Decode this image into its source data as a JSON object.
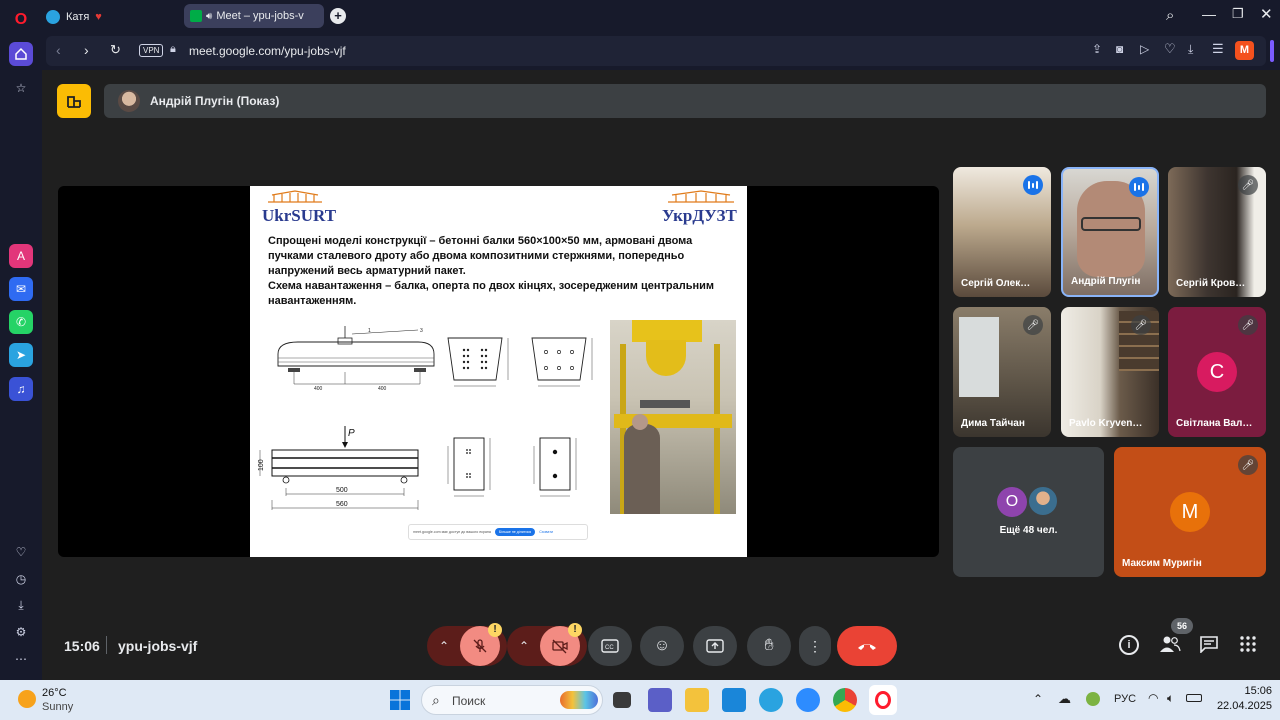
{
  "browser": {
    "tabs": [
      {
        "label": "Катя",
        "heart": "♥"
      },
      {
        "label": "Meet – ypu-jobs-v"
      }
    ],
    "address": "meet.google.com/ypu-jobs-vjf",
    "vpn_label": "VPN",
    "profile_initial": "M"
  },
  "meet": {
    "presenter": "Андрій Плугін (Показ)",
    "time": "15:06",
    "meeting_code": "ypu-jobs-vjf",
    "participant_count": "56",
    "slide": {
      "logo_left": "UkrSURT",
      "logo_right": "УкрДУЗТ",
      "paragraph1": "Спрощені моделі конструкції – бетонні балки 560×100×50 мм, армовані двома пучками сталевого дроту або двома композитними стержнями, попередньо напружений весь арматурний пакет.",
      "paragraph2": "Схема навантаження – балка, оперта по двох кінцях, зосередженим центральним навантаженням.",
      "fig_load_label": "P",
      "fig_height": "100",
      "fig_span": "500",
      "fig_length": "560",
      "fig_num1": "1",
      "fig_num3": "3",
      "fig_dim_a": "400",
      "fig_dim_b": "400",
      "share_bar_text": "meet.google.com має доступ до вашого екрана",
      "share_stop": "Більше не ділитися",
      "share_hide": "Сховати"
    },
    "tiles": [
      {
        "name": "Сергій Олек…"
      },
      {
        "name": "Андрій Плугін"
      },
      {
        "name": "Сергій Кров…"
      },
      {
        "name": "Дима Тайчан"
      },
      {
        "name": "Pavlo Kryven…"
      },
      {
        "name": "Світлана Вал…",
        "initial": "С"
      },
      {
        "name": "Ещё 48 чел.",
        "initial": "O"
      },
      {
        "name": "Максим Муригін",
        "initial": "M"
      }
    ],
    "badge": "!"
  },
  "taskbar": {
    "weather_temp": "26°C",
    "weather_desc": "Sunny",
    "search_placeholder": "Поиск",
    "lang": "РУС",
    "clock_time": "15:06",
    "clock_date": "22.04.2025"
  },
  "colors": {
    "end_call": "#ea4335",
    "mic_off_bg": "#f28b82",
    "accent_blue": "#1a73e8",
    "avatar_pink": "#d81b60",
    "avatar_orange": "#e8710a",
    "avatar_purple": "#8e44ad"
  }
}
